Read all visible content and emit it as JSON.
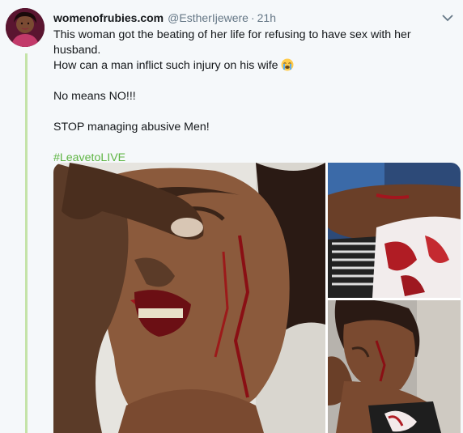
{
  "tweet": {
    "display_name": "womenofrubies.com",
    "handle": "@EstherIjewere",
    "separator": "·",
    "time": "21h",
    "line1": "This woman got the beating of her life  for refusing to have sex with her husband.",
    "line2": "How can a man inflict such injury on his wife",
    "emoji": "loudly-crying-face-emoji",
    "line3": "No means NO!!!",
    "line4": "STOP managing abusive Men!",
    "hashtag": "#LeavetoLIVE"
  },
  "icons": {
    "avatar": "profile-photo",
    "menu": "chevron-down-icon"
  },
  "media": {
    "photos": [
      "injured-face-photo",
      "injured-arm-photo",
      "injured-woman-side-photo"
    ]
  },
  "colors": {
    "background": "#f5f8fa",
    "hashtag": "#5fb544",
    "thread_line": "#c4e3a8",
    "secondary_text": "#657786"
  }
}
